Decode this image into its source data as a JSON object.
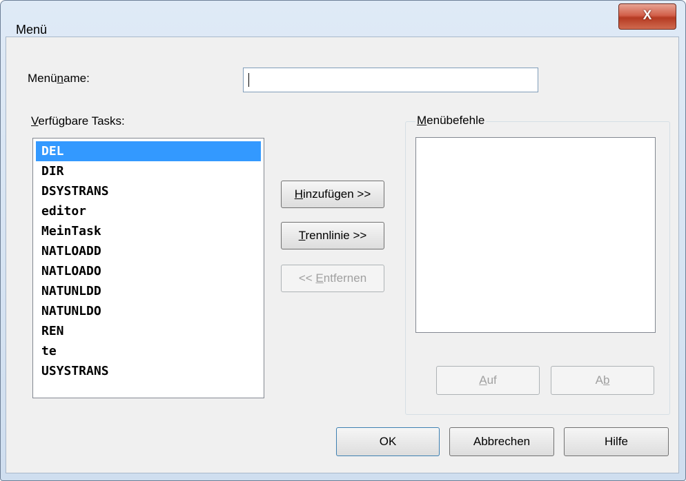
{
  "window": {
    "title": "Menü",
    "close_label": "X"
  },
  "menu_name": {
    "label_pre": "Menü",
    "label_accel": "n",
    "label_post": "ame:",
    "value": ""
  },
  "available_tasks": {
    "label_accel": "V",
    "label_post": "erfügbare Tasks:",
    "items": [
      "DEL",
      "DIR",
      "DSYSTRANS",
      "editor",
      "MeinTask",
      "NATLOADD",
      "NATLOADO",
      "NATUNLDD",
      "NATUNLDO",
      "REN",
      "te",
      "USYSTRANS"
    ],
    "selected_index": 0
  },
  "buttons": {
    "add": {
      "accel": "H",
      "rest": "inzufügen >>"
    },
    "separator": {
      "accel": "T",
      "rest": "rennlinie >>"
    },
    "remove": {
      "pre": "<< ",
      "accel": "E",
      "rest": "ntfernen"
    },
    "up": {
      "accel": "A",
      "rest": "uf"
    },
    "down": {
      "pre": "A",
      "accel": "b",
      "rest": ""
    },
    "ok": "OK",
    "cancel": "Abbrechen",
    "help": "Hilfe"
  },
  "menu_commands": {
    "label_accel": "M",
    "label_post": "enübefehle",
    "items": []
  },
  "colors": {
    "selection": "#3399ff",
    "close_button": "#c9462c",
    "dialog_bg": "#f0f0f0"
  }
}
